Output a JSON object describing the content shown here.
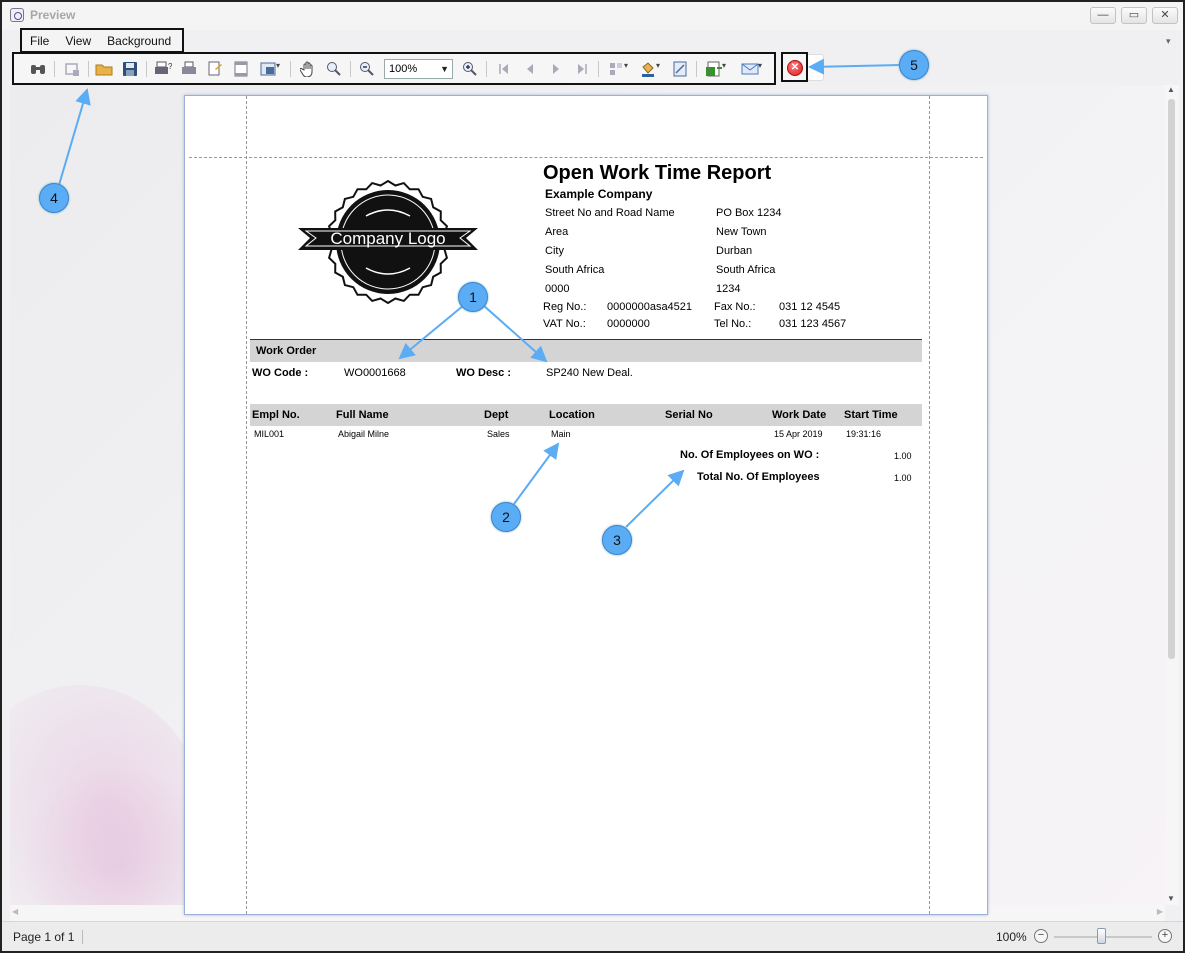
{
  "window": {
    "title": "Preview"
  },
  "menu": {
    "file": "File",
    "view": "View",
    "background": "Background"
  },
  "toolbar": {
    "zoom_value": "100%"
  },
  "report": {
    "title": "Open Work Time Report",
    "company": "Example Company",
    "logo_text": "Company Logo",
    "address_left": [
      "Street No and Road Name",
      "Area",
      "City",
      "South Africa",
      "0000"
    ],
    "address_right": [
      "PO Box 1234",
      "New Town",
      "Durban",
      "South Africa",
      "1234"
    ],
    "reg_label": "Reg No.:",
    "reg_value": "0000000asa4521",
    "vat_label": "VAT No.:",
    "vat_value": "0000000",
    "fax_label": "Fax No.:",
    "fax_value": "031 12 4545",
    "tel_label": "Tel No.:",
    "tel_value": "031 123 4567",
    "section_title": "Work Order",
    "wo_code_label": "WO Code :",
    "wo_code_value": "WO0001668",
    "wo_desc_label": "WO Desc :",
    "wo_desc_value": "SP240 New Deal.",
    "columns": {
      "empl_no": "Empl No.",
      "full_name": "Full Name",
      "dept": "Dept",
      "location": "Location",
      "serial_no": "Serial No",
      "work_date": "Work Date",
      "start_time": "Start Time"
    },
    "row": {
      "empl_no": "MIL001",
      "full_name": "Abigail Milne",
      "dept": "Sales",
      "location": "Main",
      "serial_no": "",
      "work_date": "15 Apr 2019",
      "start_time": "19:31:16"
    },
    "employees_on_wo_label": "No. Of Employees on WO :",
    "employees_on_wo_value": "1.00",
    "total_employees_label": "Total No. Of Employees",
    "total_employees_value": "1.00"
  },
  "callouts": {
    "c1": "1",
    "c2": "2",
    "c3": "3",
    "c4": "4",
    "c5": "5"
  },
  "statusbar": {
    "page_info": "Page 1 of 1",
    "zoom": "100%"
  }
}
